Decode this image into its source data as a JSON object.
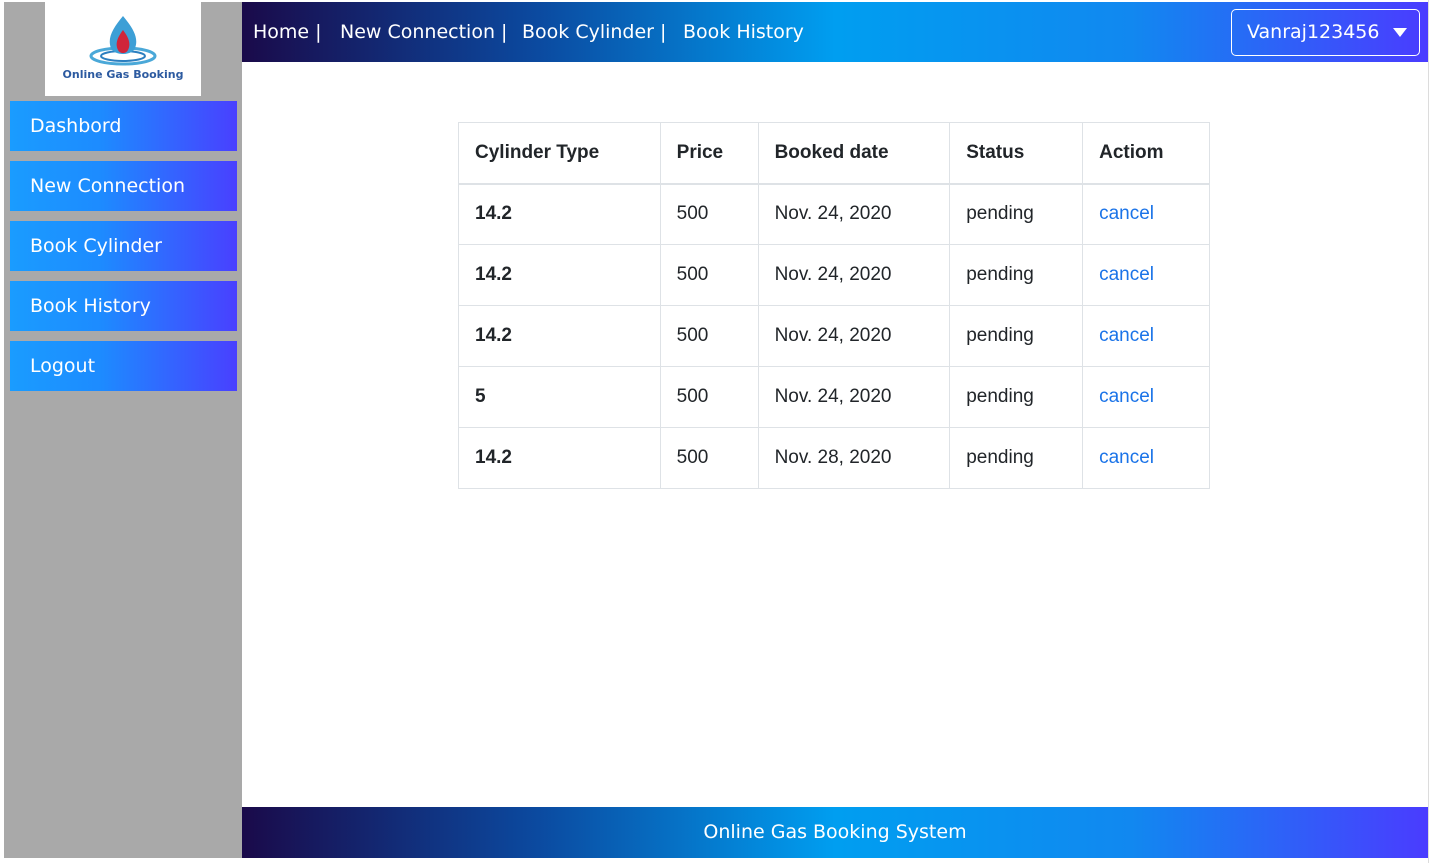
{
  "brand": {
    "logo_text": "Online Gas Booking"
  },
  "sidebar": {
    "items": [
      {
        "label": "Dashbord"
      },
      {
        "label": "New Connection"
      },
      {
        "label": "Book Cylinder"
      },
      {
        "label": "Book History"
      },
      {
        "label": "Logout"
      }
    ]
  },
  "topnav": {
    "items": [
      {
        "label": "Home |"
      },
      {
        "label": "New Connection |"
      },
      {
        "label": "Book Cylinder |"
      },
      {
        "label": "Book History"
      }
    ],
    "user": "Vanraj123456"
  },
  "table": {
    "headers": [
      "Cylinder Type",
      "Price",
      "Booked date",
      "Status",
      "Actiom"
    ],
    "rows": [
      {
        "type": "14.2",
        "price": "500",
        "date": "Nov. 24, 2020",
        "status": "pending",
        "action": "cancel"
      },
      {
        "type": "14.2",
        "price": "500",
        "date": "Nov. 24, 2020",
        "status": "pending",
        "action": "cancel"
      },
      {
        "type": "14.2",
        "price": "500",
        "date": "Nov. 24, 2020",
        "status": "pending",
        "action": "cancel"
      },
      {
        "type": "5",
        "price": "500",
        "date": "Nov. 24, 2020",
        "status": "pending",
        "action": "cancel"
      },
      {
        "type": "14.2",
        "price": "500",
        "date": "Nov. 28, 2020",
        "status": "pending",
        "action": "cancel"
      }
    ]
  },
  "footer": {
    "text": "Online Gas Booking System"
  },
  "colors": {
    "link": "#1a73e8",
    "sidebar_bg": "#a9a9a9",
    "accent_start": "#1a0a4a",
    "accent_end": "#4a3cff"
  }
}
